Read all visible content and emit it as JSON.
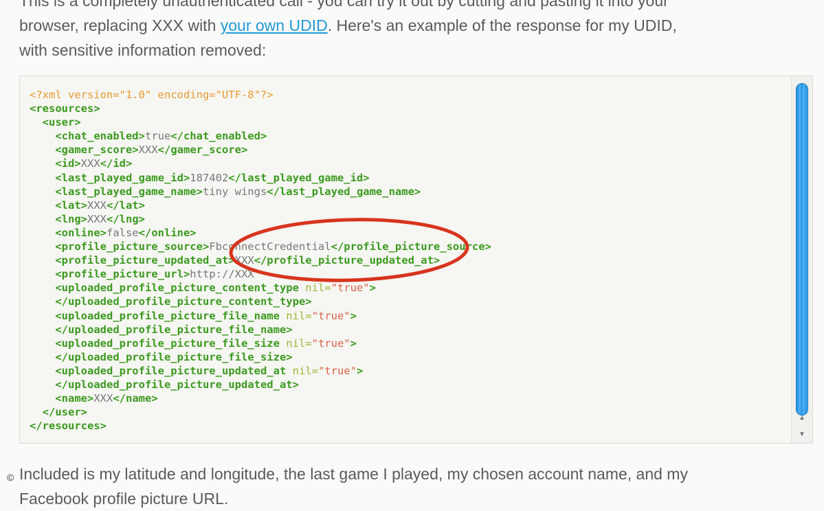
{
  "prose_top": {
    "line1": "This is a completely unauthenticated call - you can try it out by cutting and pasting it into your",
    "line2_before": "browser, replacing XXX with ",
    "link": "your own UDID",
    "line2_after": ". Here's an example of the response for my UDID,",
    "line3": "with sensitive information removed:"
  },
  "code": {
    "declaration": "<?xml version=\"1.0\" encoding=\"UTF-8\"?>",
    "open_resources": "<resources>",
    "open_user": "<user>",
    "chat_enabled": {
      "open": "<chat_enabled>",
      "value": "true",
      "close": "</chat_enabled>"
    },
    "gamer_score": {
      "open": "<gamer_score>",
      "value": "XXX",
      "close": "</gamer_score>"
    },
    "id": {
      "open": "<id>",
      "value": "XXX",
      "close": "</id>"
    },
    "last_played_game_id": {
      "open": "<last_played_game_id>",
      "value": "187402",
      "close": "</last_played_game_id>"
    },
    "last_played_game_name": {
      "open": "<last_played_game_name>",
      "value": "tiny wings",
      "close": "</last_played_game_name>"
    },
    "lat": {
      "open": "<lat>",
      "value": "XXX",
      "close": "</lat>"
    },
    "lng": {
      "open": "<lng>",
      "value": "XXX",
      "close": "</lng>"
    },
    "online": {
      "open": "<online>",
      "value": "false",
      "close": "</online>"
    },
    "profile_picture_source": {
      "open": "<profile_picture_source>",
      "value": "FbconnectCredential",
      "close": "</profile_picture_source>"
    },
    "profile_picture_updated_at": {
      "open": "<profile_picture_updated_at>",
      "value": "XXX",
      "close": "</profile_picture_updated_at>"
    },
    "profile_picture_url": {
      "open": "<profile_picture_url>",
      "value": "http://XXX",
      "close": ""
    },
    "content_type_open": {
      "open": "<uploaded_profile_picture_content_type",
      "attr": " nil=",
      "str": "\"true\"",
      "end": ">"
    },
    "content_type_close": "</uploaded_profile_picture_content_type>",
    "file_name_open": {
      "open": "<uploaded_profile_picture_file_name",
      "attr": " nil=",
      "str": "\"true\"",
      "end": ">"
    },
    "file_name_close": "</uploaded_profile_picture_file_name>",
    "file_size_open": {
      "open": "<uploaded_profile_picture_file_size",
      "attr": " nil=",
      "str": "\"true\"",
      "end": ">"
    },
    "file_size_close": "</uploaded_profile_picture_file_size>",
    "updated_at_open": {
      "open": "<uploaded_profile_picture_updated_at",
      "attr": " nil=",
      "str": "\"true\"",
      "end": ">"
    },
    "updated_at_close": "</uploaded_profile_picture_updated_at>",
    "name": {
      "open": "<name>",
      "value": "XXX",
      "close": "</name>"
    },
    "close_user": "</user>",
    "close_resources": "</resources>"
  },
  "prose_bottom": {
    "line1": "Included is my latitude and longitude, the last game I played, my chosen account name, and my",
    "line2": "Facebook profile picture URL."
  },
  "scrollbar": {
    "up_arrow": "▲",
    "down_arrow": "▼"
  },
  "watermark": "©",
  "colors": {
    "tag": "#3b9a1f",
    "declaration": "#e69a32",
    "string": "#d9634a",
    "link": "#1f9ad6",
    "highlight_ellipse": "#d8341e",
    "scroll_thumb": "#2e9be8"
  }
}
